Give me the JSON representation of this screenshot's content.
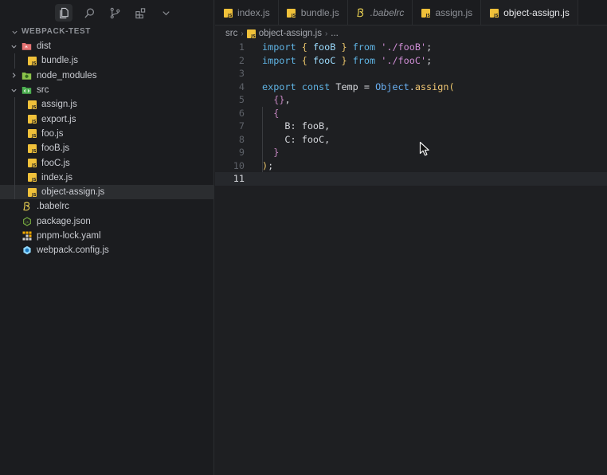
{
  "activity_bar": {
    "icons": [
      "files-icon",
      "search-icon",
      "source-control-icon",
      "extensions-icon",
      "chevron-down-icon"
    ]
  },
  "explorer": {
    "title": "WEBPACK-TEST",
    "items": [
      {
        "label": "dist",
        "type": "folder",
        "open": true,
        "depth": 0
      },
      {
        "label": "bundle.js",
        "type": "js",
        "depth": 1
      },
      {
        "label": "node_modules",
        "type": "folder",
        "open": false,
        "depth": 0
      },
      {
        "label": "src",
        "type": "folder",
        "open": true,
        "depth": 0
      },
      {
        "label": "assign.js",
        "type": "js",
        "depth": 1
      },
      {
        "label": "export.js",
        "type": "js",
        "depth": 1
      },
      {
        "label": "foo.js",
        "type": "js",
        "depth": 1
      },
      {
        "label": "fooB.js",
        "type": "js",
        "depth": 1
      },
      {
        "label": "fooC.js",
        "type": "js",
        "depth": 1
      },
      {
        "label": "index.js",
        "type": "js",
        "depth": 1
      },
      {
        "label": "object-assign.js",
        "type": "js",
        "depth": 1,
        "selected": true
      },
      {
        "label": ".babelrc",
        "type": "babel",
        "depth": 0
      },
      {
        "label": "package.json",
        "type": "json",
        "depth": 0
      },
      {
        "label": "pnpm-lock.yaml",
        "type": "yaml",
        "depth": 0
      },
      {
        "label": "webpack.config.js",
        "type": "webpack",
        "depth": 0
      }
    ]
  },
  "tabs": [
    {
      "label": "index.js",
      "type": "js"
    },
    {
      "label": "bundle.js",
      "type": "js"
    },
    {
      "label": ".babelrc",
      "type": "babel"
    },
    {
      "label": "assign.js",
      "type": "js"
    },
    {
      "label": "object-assign.js",
      "type": "js",
      "active": true
    }
  ],
  "breadcrumb": {
    "folder": "src",
    "file": "object-assign.js",
    "more": "..."
  },
  "editor": {
    "current_line": 11,
    "lines": [
      {
        "n": "1",
        "tokens": [
          [
            "kw",
            "import"
          ],
          [
            "plain",
            " "
          ],
          [
            "brace",
            "{"
          ],
          [
            "plain",
            " "
          ],
          [
            "id",
            "fooB"
          ],
          [
            "plain",
            " "
          ],
          [
            "brace",
            "}"
          ],
          [
            "plain",
            " "
          ],
          [
            "kw",
            "from"
          ],
          [
            "plain",
            " "
          ],
          [
            "str",
            "'./fooB'"
          ],
          [
            "plain",
            ";"
          ]
        ]
      },
      {
        "n": "2",
        "tokens": [
          [
            "kw",
            "import"
          ],
          [
            "plain",
            " "
          ],
          [
            "brace",
            "{"
          ],
          [
            "plain",
            " "
          ],
          [
            "id",
            "fooC"
          ],
          [
            "plain",
            " "
          ],
          [
            "brace",
            "}"
          ],
          [
            "plain",
            " "
          ],
          [
            "kw",
            "from"
          ],
          [
            "plain",
            " "
          ],
          [
            "str",
            "'./fooC'"
          ],
          [
            "plain",
            ";"
          ]
        ]
      },
      {
        "n": "3",
        "tokens": []
      },
      {
        "n": "4",
        "tokens": [
          [
            "kw",
            "export"
          ],
          [
            "plain",
            " "
          ],
          [
            "kw",
            "const"
          ],
          [
            "plain",
            " Temp = "
          ],
          [
            "cls",
            "Object"
          ],
          [
            "plain",
            "."
          ],
          [
            "fn",
            "assign"
          ],
          [
            "paren",
            "("
          ]
        ]
      },
      {
        "n": "5",
        "tokens": [
          [
            "plain",
            "  "
          ],
          [
            "brace2",
            "{}"
          ],
          [
            "plain",
            ","
          ]
        ]
      },
      {
        "n": "6",
        "tokens": [
          [
            "plain",
            "  "
          ],
          [
            "brace2",
            "{"
          ]
        ]
      },
      {
        "n": "7",
        "tokens": [
          [
            "plain",
            "    B: fooB,"
          ]
        ]
      },
      {
        "n": "8",
        "tokens": [
          [
            "plain",
            "    C: fooC,"
          ]
        ]
      },
      {
        "n": "9",
        "tokens": [
          [
            "plain",
            "  "
          ],
          [
            "brace2",
            "}"
          ]
        ]
      },
      {
        "n": "10",
        "tokens": [
          [
            "paren",
            ")"
          ],
          [
            "plain",
            ";"
          ]
        ]
      },
      {
        "n": "11",
        "tokens": []
      }
    ]
  }
}
